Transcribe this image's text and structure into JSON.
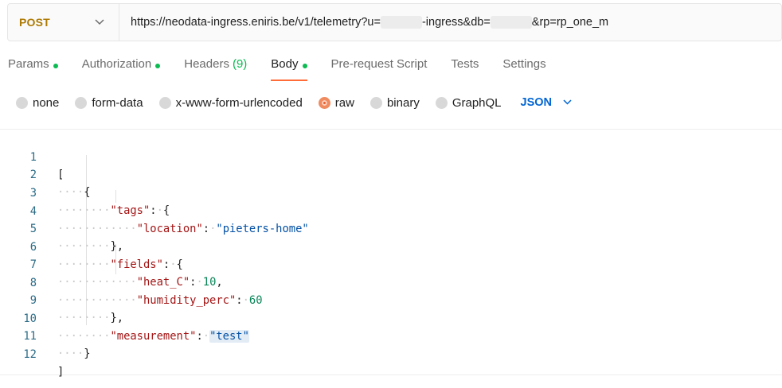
{
  "request": {
    "method": "POST",
    "url_part1": "https://neodata-ingress.eniris.be/v1/telemetry?u=",
    "url_part2": "-ingress&db=",
    "url_part3": "&rp=rp_one_m"
  },
  "tabs": [
    {
      "label": "Params",
      "dot": true
    },
    {
      "label": "Authorization",
      "dot": true
    },
    {
      "label": "Headers",
      "count": "(9)"
    },
    {
      "label": "Body",
      "dot": true,
      "active": true
    },
    {
      "label": "Pre-request Script"
    },
    {
      "label": "Tests"
    },
    {
      "label": "Settings"
    }
  ],
  "body_types": [
    {
      "label": "none",
      "selected": false
    },
    {
      "label": "form-data",
      "selected": false
    },
    {
      "label": "x-www-form-urlencoded",
      "selected": false
    },
    {
      "label": "raw",
      "selected": true
    },
    {
      "label": "binary",
      "selected": false
    },
    {
      "label": "GraphQL",
      "selected": false
    }
  ],
  "format": "JSON",
  "code": {
    "line_numbers": [
      "1",
      "2",
      "3",
      "4",
      "5",
      "6",
      "7",
      "8",
      "9",
      "10",
      "11",
      "12"
    ],
    "open_bracket": "[",
    "close_bracket": "]",
    "open_brace": "{",
    "close_brace": "}",
    "close_brace_comma": "},",
    "key_tags": "\"tags\"",
    "key_location": "\"location\"",
    "val_location": "\"pieters-home\"",
    "key_fields": "\"fields\"",
    "key_heat": "\"heat_C\"",
    "val_heat": "10",
    "key_humidity": "\"humidity_perc\"",
    "val_humidity": "60",
    "key_measurement": "\"measurement\"",
    "val_measurement": "\"test\""
  },
  "colors": {
    "accent": "#ff6c37",
    "method": "#ad7a03",
    "status_dot": "#0cbb52",
    "link": "#0265d2"
  }
}
